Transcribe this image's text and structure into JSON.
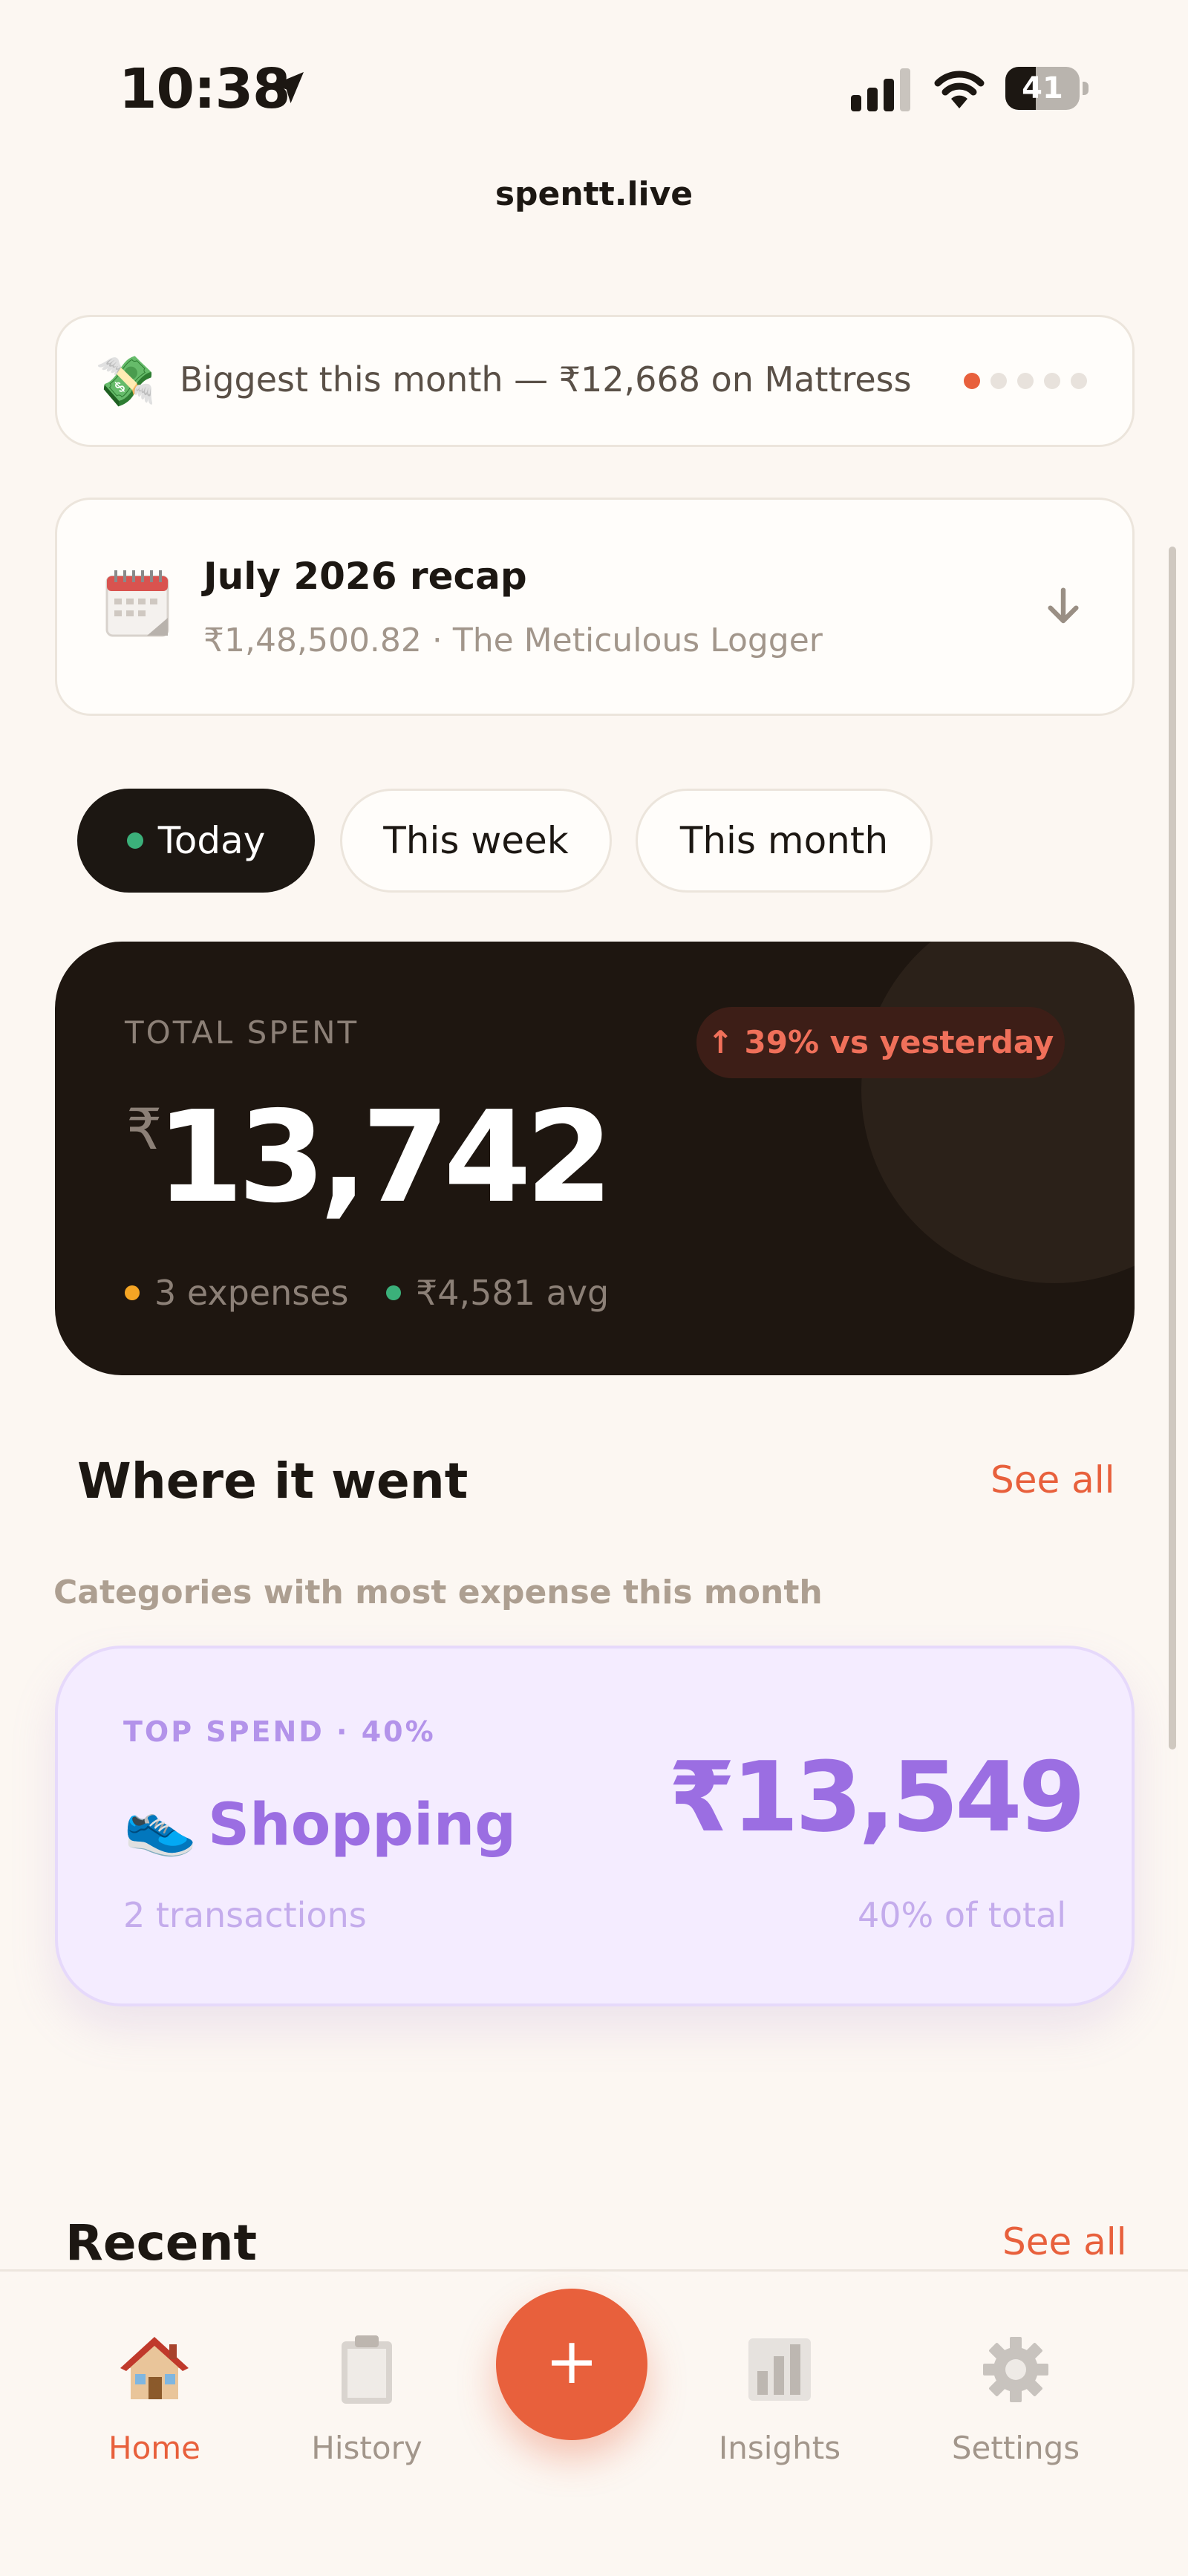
{
  "status_bar": {
    "time": "10:38",
    "battery": "41",
    "battery_level": 0.41
  },
  "site": {
    "url": "spentt.live"
  },
  "banner": {
    "icon": "money-with-wings-icon",
    "text": "Biggest this month — ₹12,668 on Mattress",
    "page_count": 5,
    "active_page": 1
  },
  "recap": {
    "icon": "calendar-icon",
    "title": "July 2026 recap",
    "subtitle": "₹1,48,500.82 · The Meticulous Logger"
  },
  "tabs": [
    {
      "label": "Today",
      "active": true
    },
    {
      "label": "This week",
      "active": false
    },
    {
      "label": "This month",
      "active": false
    }
  ],
  "total": {
    "label": "TOTAL SPENT",
    "currency": "₹",
    "amount": "13,742",
    "change": "↑ 39% vs yesterday",
    "expenses": "3 expenses",
    "avg": "₹4,581 avg"
  },
  "where": {
    "title": "Where it went",
    "see_all": "See all",
    "caption": "Categories with most expense this month",
    "top": {
      "label": "TOP SPEND · 40%",
      "icon": "sneaker-icon",
      "name": "Shopping",
      "amount": "₹13,549",
      "transactions": "2 transactions",
      "percent": "40% of total"
    }
  },
  "recent": {
    "title": "Recent",
    "see_all": "See all"
  },
  "nav": {
    "items": [
      {
        "label": "Home",
        "icon": "house-icon",
        "active": true
      },
      {
        "label": "History",
        "icon": "clipboard-icon",
        "active": false
      },
      {
        "label": "Insights",
        "icon": "bar-chart-icon",
        "active": false
      },
      {
        "label": "Settings",
        "icon": "gear-icon",
        "active": false
      }
    ],
    "fab_label": "+"
  },
  "colors": {
    "accent": "#e8603c",
    "background": "#fcf7f2",
    "dark_card": "#1e1610",
    "shopping": "#9b6ee2",
    "positive_dot": "#3bb07a",
    "warning_dot": "#f5a524"
  }
}
